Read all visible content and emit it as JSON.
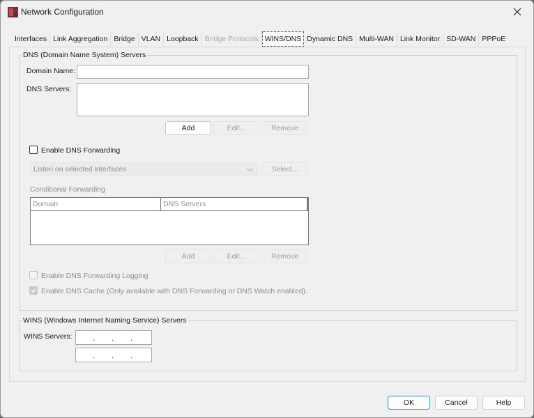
{
  "window": {
    "title": "Network Configuration",
    "icon": "app-logo-icon",
    "close_icon": "close-icon"
  },
  "tabs": [
    {
      "label": "Interfaces",
      "state": "normal"
    },
    {
      "label": "Link Aggregation",
      "state": "normal"
    },
    {
      "label": "Bridge",
      "state": "normal"
    },
    {
      "label": "VLAN",
      "state": "normal"
    },
    {
      "label": "Loopback",
      "state": "normal"
    },
    {
      "label": "Bridge Protocols",
      "state": "disabled"
    },
    {
      "label": "WINS/DNS",
      "state": "active"
    },
    {
      "label": "Dynamic DNS",
      "state": "normal"
    },
    {
      "label": "Multi-WAN",
      "state": "normal"
    },
    {
      "label": "Link Monitor",
      "state": "normal"
    },
    {
      "label": "SD-WAN",
      "state": "normal"
    },
    {
      "label": "PPPoE",
      "state": "normal"
    }
  ],
  "dns": {
    "group_title": "DNS (Domain Name System) Servers",
    "domain_name_label": "Domain Name:",
    "domain_name_value": "",
    "dns_servers_label": "DNS Servers:",
    "dns_servers_list": [],
    "add_label": "Add",
    "edit_label": "Edit...",
    "remove_label": "Remove",
    "enable_forwarding_label": "Enable DNS Forwarding",
    "enable_forwarding_checked": false,
    "listen_dropdown_value": "Listen on selected interfaces",
    "select_label": "Select...",
    "conditional_forwarding_label": "Conditional Forwarding",
    "cf_table": {
      "columns": [
        "Domain",
        "DNS Servers"
      ],
      "rows": []
    },
    "cf_add_label": "Add",
    "cf_edit_label": "Edit...",
    "cf_remove_label": "Remove",
    "forwarding_logging_label": "Enable DNS Forwarding Logging",
    "forwarding_logging_checked": false,
    "cache_label": "Enable DNS Cache (Only available with DNS Forwarding or DNS Watch enabled).",
    "cache_checked": true
  },
  "wins": {
    "group_title": "WINS (Windows Internet Naming Service) Servers",
    "servers_label": "WINS Servers:",
    "server_1": "   .   .   .   ",
    "server_2": "   .   .   .   "
  },
  "footer": {
    "ok_label": "OK",
    "cancel_label": "Cancel",
    "help_label": "Help"
  }
}
